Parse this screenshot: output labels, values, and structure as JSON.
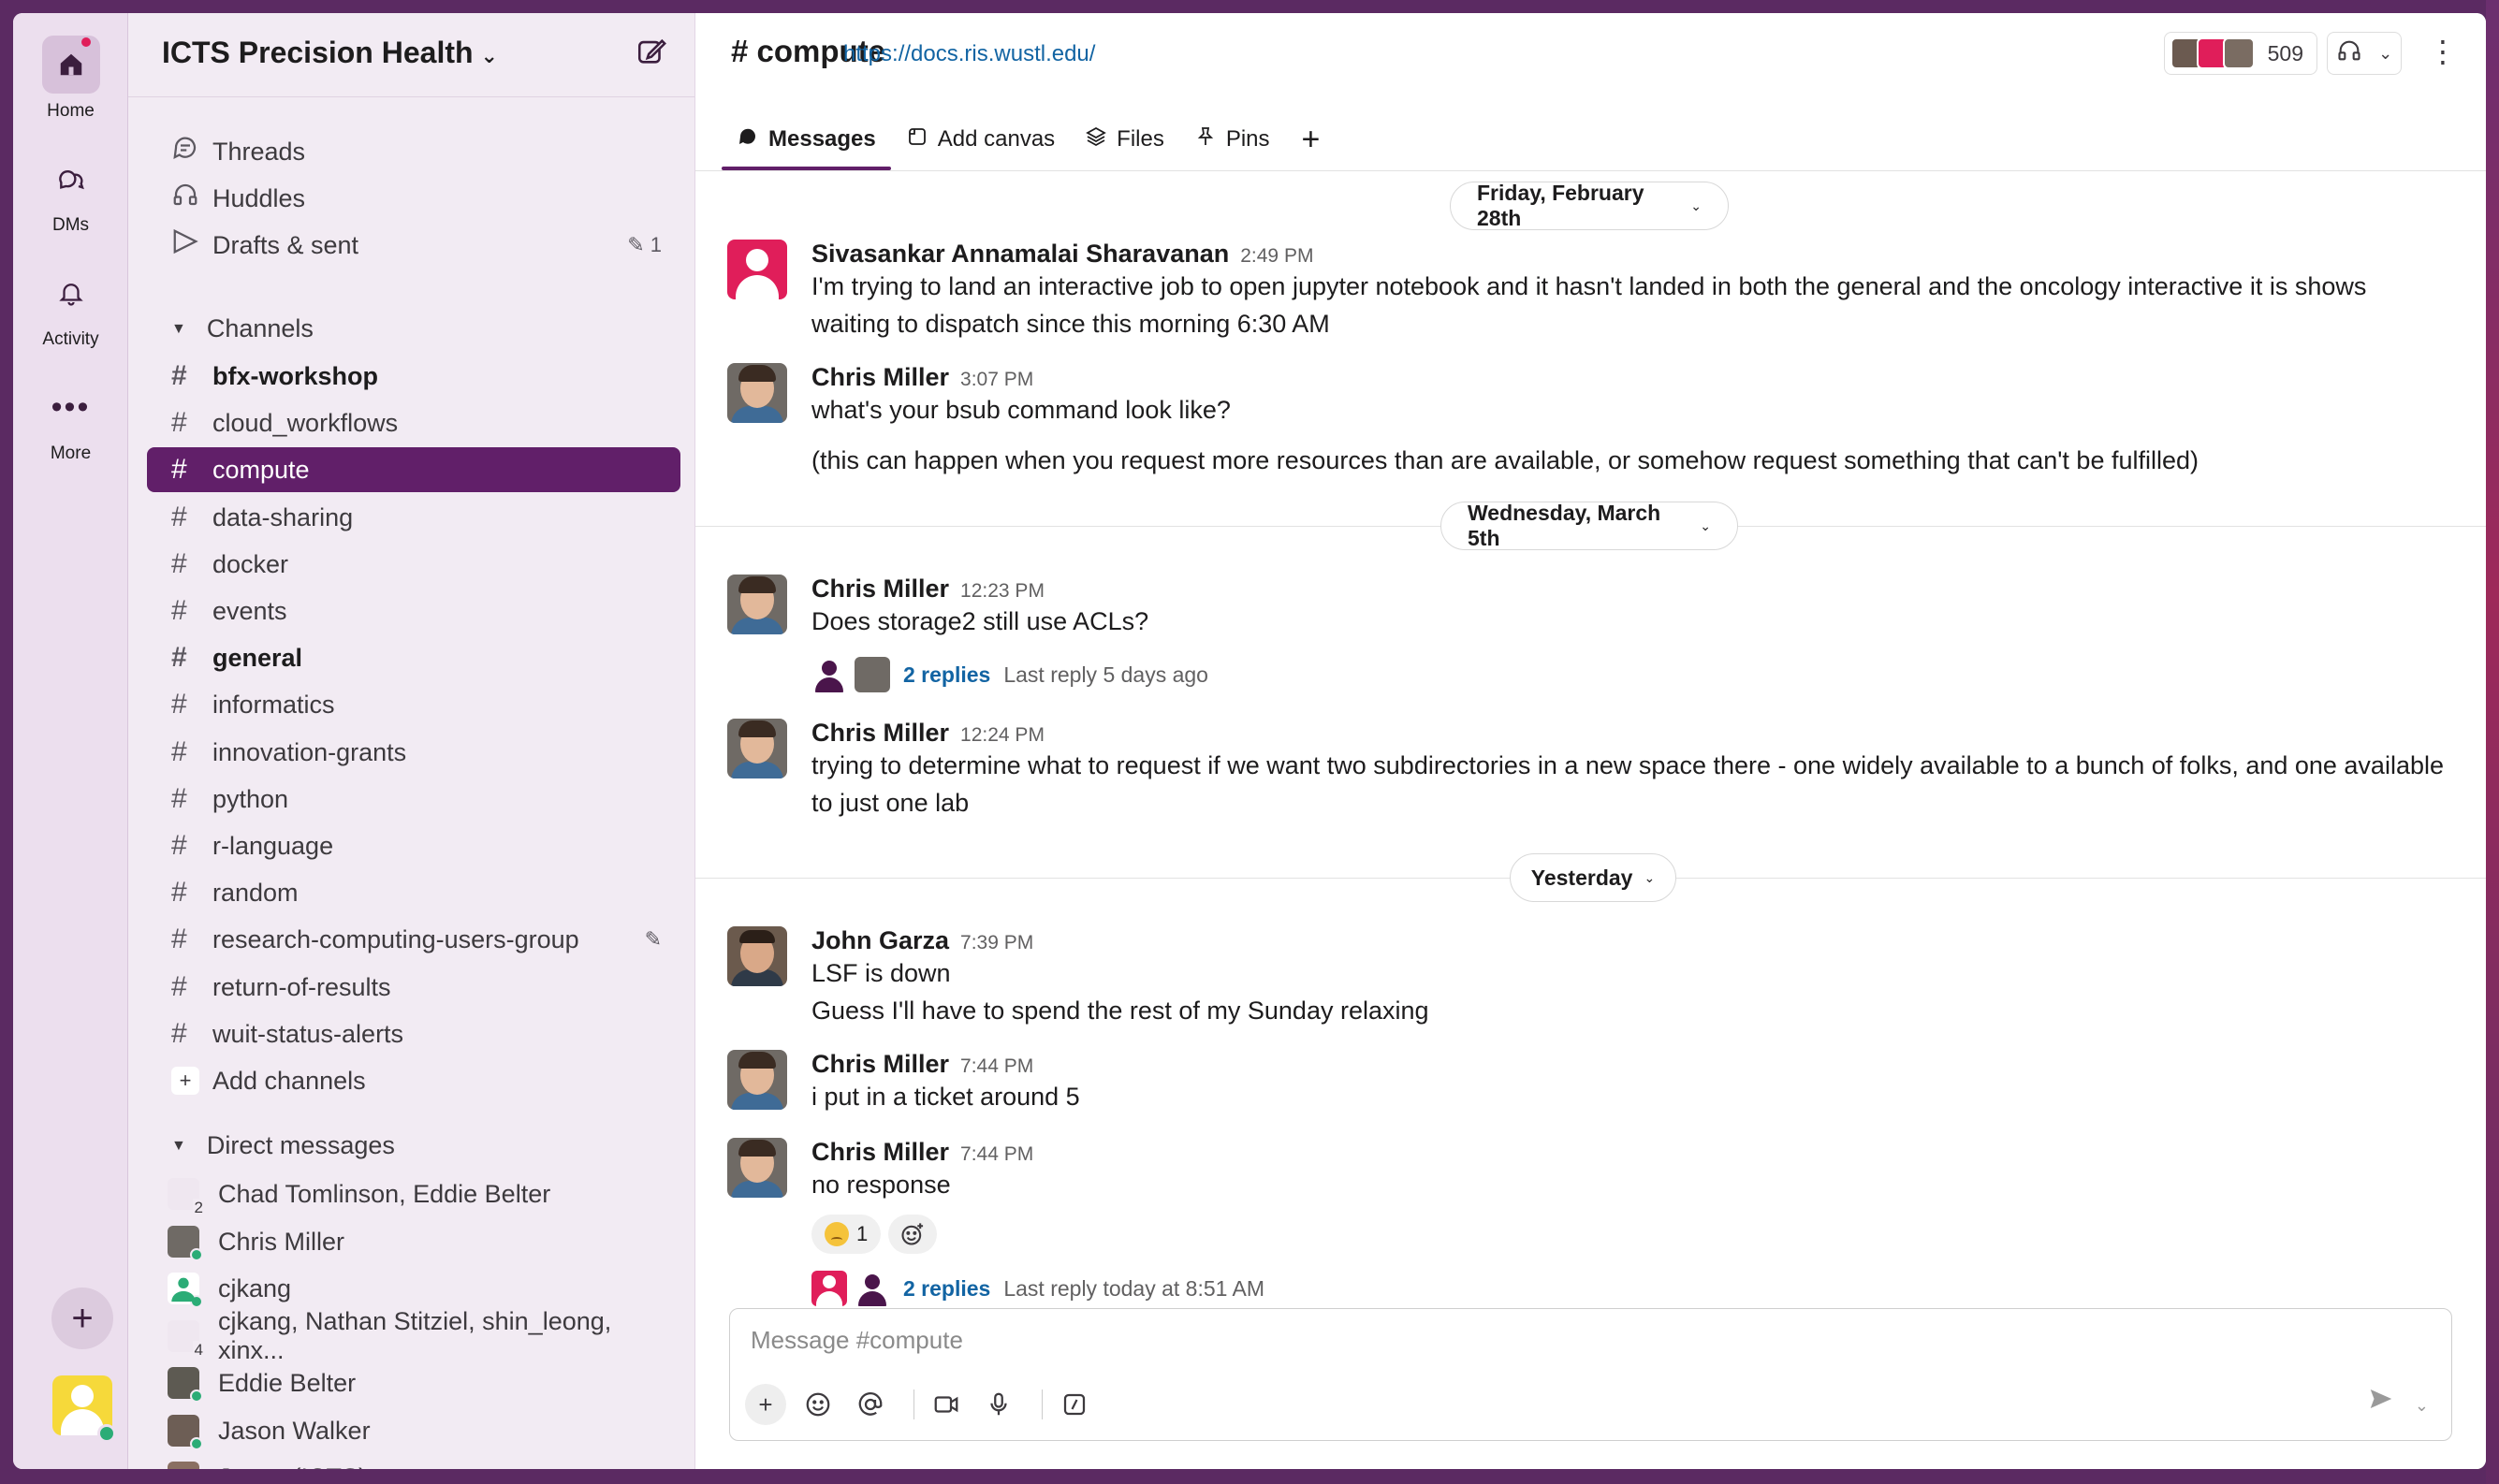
{
  "rail": {
    "home": "Home",
    "dms": "DMs",
    "activity": "Activity",
    "more": "More"
  },
  "workspace": {
    "name": "ICTS Precision Health"
  },
  "sidebar": {
    "top_items": [
      {
        "label": "Threads"
      },
      {
        "label": "Huddles"
      },
      {
        "label": "Drafts & sent",
        "count": "1"
      }
    ],
    "channels_header": "Channels",
    "channels": [
      {
        "name": "bfx-workshop",
        "bold": true
      },
      {
        "name": "cloud_workflows"
      },
      {
        "name": "compute",
        "active": true
      },
      {
        "name": "data-sharing"
      },
      {
        "name": "docker"
      },
      {
        "name": "events"
      },
      {
        "name": "general",
        "bold": true
      },
      {
        "name": "informatics"
      },
      {
        "name": "innovation-grants"
      },
      {
        "name": "python"
      },
      {
        "name": "r-language"
      },
      {
        "name": "random"
      },
      {
        "name": "research-computing-users-group"
      },
      {
        "name": "return-of-results"
      },
      {
        "name": "wuit-status-alerts"
      }
    ],
    "add_channels": "Add channels",
    "dm_header": "Direct messages",
    "dms": [
      {
        "name": "Chad Tomlinson, Eddie Belter",
        "count": "2"
      },
      {
        "name": "Chris Miller"
      },
      {
        "name": "cjkang"
      },
      {
        "name": "cjkang, Nathan Stitziel, shin_leong, xinx...",
        "count": "4"
      },
      {
        "name": "Eddie Belter"
      },
      {
        "name": "Jason Walker"
      },
      {
        "name": "Jenny (ICTS)"
      }
    ]
  },
  "channel": {
    "title": "# compute",
    "link": "https://docs.ris.wustl.edu/",
    "member_count": "509",
    "tabs": {
      "messages": "Messages",
      "canvas": "Add canvas",
      "files": "Files",
      "pins": "Pins"
    }
  },
  "dates": {
    "d1": "Friday, February 28th",
    "d2": "Wednesday, March 5th",
    "d3": "Yesterday"
  },
  "messages": [
    {
      "author": "Sivasankar Annamalai Sharavanan",
      "time": "2:49 PM",
      "text": "I'm trying to land an interactive job to open jupyter notebook and it hasn't landed in both the general and the oncology interactive it is shows waiting to dispatch since this morning 6:30 AM"
    },
    {
      "author": "Chris Miller",
      "time": "3:07 PM",
      "text": "what's your bsub command look like?",
      "text2": "(this can happen when you request more resources than are available, or somehow request something that can't be fulfilled)"
    },
    {
      "author": "Chris Miller",
      "time": "12:23 PM",
      "text": "Does storage2 still use ACLs?",
      "replies": "2 replies",
      "last_reply": "Last reply 5 days ago"
    },
    {
      "author": "Chris Miller",
      "time": "12:24 PM",
      "text": "trying to determine what to request if we want two subdirectories in a new space there - one widely available to a bunch of folks, and one available to just one lab"
    },
    {
      "author": "John Garza",
      "time": "7:39 PM",
      "text": "LSF is down",
      "text2": "Guess I'll have to spend the rest of my Sunday relaxing"
    },
    {
      "author": "Chris Miller",
      "time": "7:44 PM",
      "text": "i put in a ticket around 5"
    },
    {
      "author": "Chris Miller",
      "time": "7:44 PM",
      "text": "no response",
      "reaction_count": "1",
      "replies": "2 replies",
      "last_reply": "Last reply today at 8:51 AM"
    }
  ],
  "composer": {
    "placeholder": "Message #compute"
  }
}
